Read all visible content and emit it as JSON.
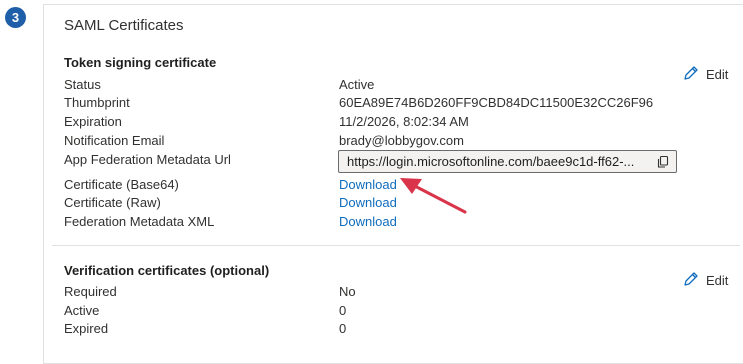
{
  "step": {
    "number": "3"
  },
  "panel": {
    "title": "SAML Certificates"
  },
  "token_signing": {
    "title": "Token signing certificate",
    "edit_label": "Edit",
    "rows": {
      "status": {
        "label": "Status",
        "value": "Active"
      },
      "thumbprint": {
        "label": "Thumbprint",
        "value": "60EA89E74B6D260FF9CBD84DC11500E32CC26F96"
      },
      "expiration": {
        "label": "Expiration",
        "value": "11/2/2026, 8:02:34 AM"
      },
      "notification_email": {
        "label": "Notification Email",
        "value": "brady@lobbygov.com"
      },
      "metadata_url": {
        "label": "App Federation Metadata Url",
        "value": "https://login.microsoftonline.com/baee9c1d-ff62-..."
      },
      "cert_base64": {
        "label": "Certificate (Base64)",
        "value": "Download"
      },
      "cert_raw": {
        "label": "Certificate (Raw)",
        "value": "Download"
      },
      "federation_xml": {
        "label": "Federation Metadata XML",
        "value": "Download"
      }
    }
  },
  "verification": {
    "title": "Verification certificates (optional)",
    "edit_label": "Edit",
    "rows": {
      "required": {
        "label": "Required",
        "value": "No"
      },
      "active": {
        "label": "Active",
        "value": "0"
      },
      "expired": {
        "label": "Expired",
        "value": "0"
      }
    }
  },
  "colors": {
    "step_badge": "#1f5ea8",
    "link": "#0f6cbd",
    "annotation_arrow": "#d9344a"
  },
  "icons": {
    "edit": "pencil-icon",
    "copy": "copy-icon",
    "annotation": "arrow-annotation"
  }
}
